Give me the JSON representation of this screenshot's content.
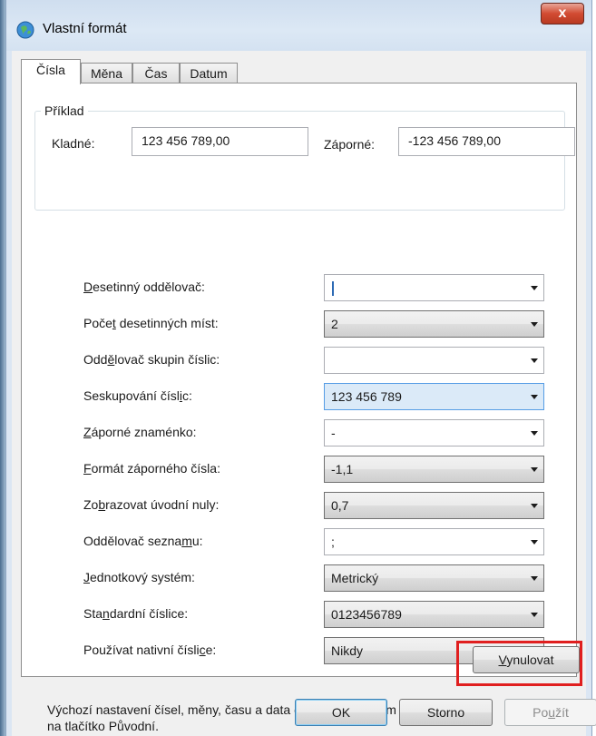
{
  "window": {
    "title": "Vlastní formát",
    "close_glyph": "x"
  },
  "tabs": [
    {
      "label": "Čísla",
      "active": true
    },
    {
      "label": "Měna",
      "active": false
    },
    {
      "label": "Čas",
      "active": false
    },
    {
      "label": "Datum",
      "active": false
    }
  ],
  "example": {
    "group_label": "Příklad",
    "positive_label": "Kladné:",
    "positive_value": "123 456 789,00",
    "negative_label": "Záporné:",
    "negative_value": "-123 456 789,00"
  },
  "settings": [
    {
      "label_pre": "",
      "label_ul": "D",
      "label_post": "esetinný oddělovač:",
      "value": "",
      "style": "field",
      "focused": true
    },
    {
      "label_pre": "Poče",
      "label_ul": "t",
      "label_post": " desetinných míst:",
      "value": "2",
      "style": "button"
    },
    {
      "label_pre": "Odd",
      "label_ul": "ě",
      "label_post": "lovač skupin číslic:",
      "value": "",
      "style": "field"
    },
    {
      "label_pre": "Seskupování čísl",
      "label_ul": "i",
      "label_post": "c:",
      "value": "123 456 789",
      "style": "selected"
    },
    {
      "label_pre": "",
      "label_ul": "Z",
      "label_post": "áporné znaménko:",
      "value": "-",
      "style": "field"
    },
    {
      "label_pre": "",
      "label_ul": "F",
      "label_post": "ormát záporného čísla:",
      "value": "-1,1",
      "style": "button"
    },
    {
      "label_pre": "Zo",
      "label_ul": "b",
      "label_post": "razovat úvodní nuly:",
      "value": "0,7",
      "style": "button"
    },
    {
      "label_pre": "Oddělovač sezna",
      "label_ul": "m",
      "label_post": "u:",
      "value": ";",
      "style": "field"
    },
    {
      "label_pre": "",
      "label_ul": "J",
      "label_post": "ednotkový systém:",
      "value": "Metrický",
      "style": "button"
    },
    {
      "label_pre": "Sta",
      "label_ul": "n",
      "label_post": "dardní číslice:",
      "value": "0123456789",
      "style": "button"
    },
    {
      "label_pre": "Používat nativní čísli",
      "label_ul": "c",
      "label_post": "e:",
      "value": "Nikdy",
      "style": "button"
    }
  ],
  "reset": {
    "info_line1": "Výchozí nastavení čísel, měny, času a data obnovíte kliknutím",
    "info_line2": "na tlačítko Původní.",
    "button_ul": "V",
    "button_rest": "ynulovat"
  },
  "footer": {
    "ok_label": "OK",
    "cancel_label": "Storno",
    "apply_pre": "Po",
    "apply_ul": "u",
    "apply_post": "žít"
  },
  "colors": {
    "highlight": "#e01f1f",
    "accent": "#569de5"
  }
}
